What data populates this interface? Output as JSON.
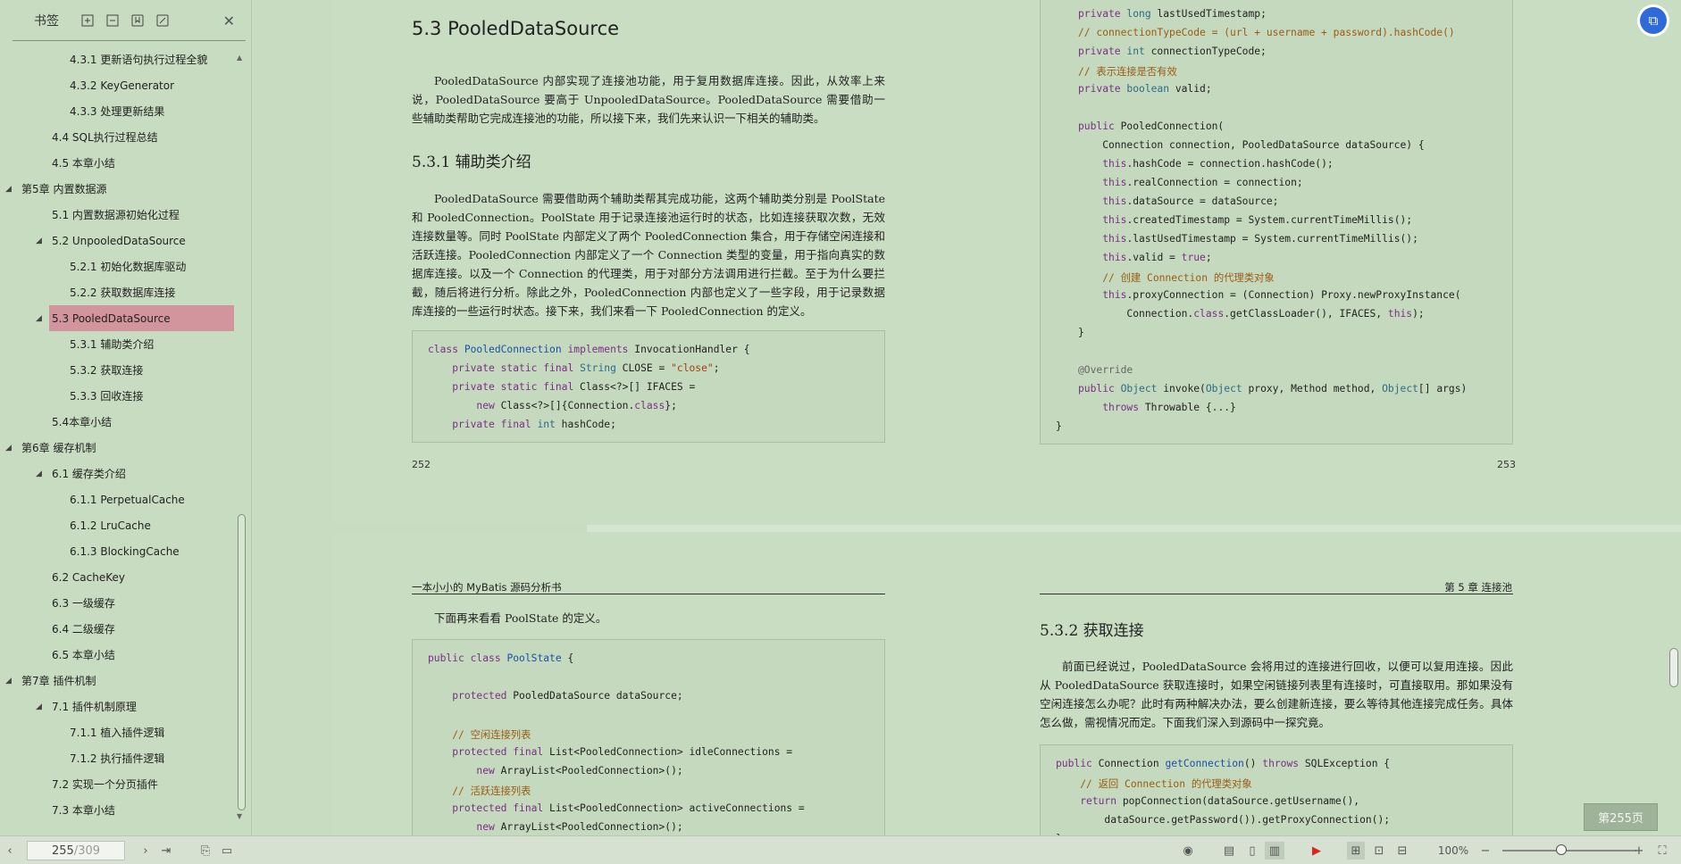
{
  "sidebar": {
    "title": "书签",
    "close_icon": "close-icon",
    "items": [
      {
        "label": "4.3.1 更新语句执行过程全貌",
        "level": 3,
        "toggle": ""
      },
      {
        "label": "4.3.2 KeyGenerator",
        "level": 3,
        "toggle": ""
      },
      {
        "label": "4.3.3 处理更新结果",
        "level": 3,
        "toggle": ""
      },
      {
        "label": "4.4 SQL执行过程总结",
        "level": 2,
        "toggle": ""
      },
      {
        "label": "4.5 本章小结",
        "level": 2,
        "toggle": ""
      },
      {
        "label": "第5章 内置数据源",
        "level": 1,
        "toggle": "◢"
      },
      {
        "label": "5.1 内置数据源初始化过程",
        "level": 2,
        "toggle": ""
      },
      {
        "label": "5.2 UnpooledDataSource",
        "level": 2,
        "toggle": "◢"
      },
      {
        "label": "5.2.1 初始化数据库驱动",
        "level": 3,
        "toggle": ""
      },
      {
        "label": "5.2.2 获取数据库连接",
        "level": 3,
        "toggle": ""
      },
      {
        "label": "5.3 PooledDataSource",
        "level": 2,
        "toggle": "◢",
        "selected": true
      },
      {
        "label": "5.3.1 辅助类介绍",
        "level": 3,
        "toggle": ""
      },
      {
        "label": "5.3.2 获取连接",
        "level": 3,
        "toggle": ""
      },
      {
        "label": "5.3.3 回收连接",
        "level": 3,
        "toggle": ""
      },
      {
        "label": "5.4本章小结",
        "level": 2,
        "toggle": ""
      },
      {
        "label": "第6章 缓存机制",
        "level": 1,
        "toggle": "◢"
      },
      {
        "label": "6.1 缓存类介绍",
        "level": 2,
        "toggle": "◢"
      },
      {
        "label": "6.1.1 PerpetualCache",
        "level": 3,
        "toggle": ""
      },
      {
        "label": "6.1.2 LruCache",
        "level": 3,
        "toggle": ""
      },
      {
        "label": "6.1.3 BlockingCache",
        "level": 3,
        "toggle": ""
      },
      {
        "label": "6.2 CacheKey",
        "level": 2,
        "toggle": ""
      },
      {
        "label": "6.3 一级缓存",
        "level": 2,
        "toggle": ""
      },
      {
        "label": "6.4 二级缓存",
        "level": 2,
        "toggle": ""
      },
      {
        "label": "6.5 本章小结",
        "level": 2,
        "toggle": ""
      },
      {
        "label": "第7章 插件机制",
        "level": 1,
        "toggle": "◢"
      },
      {
        "label": "7.1 插件机制原理",
        "level": 2,
        "toggle": "◢"
      },
      {
        "label": "7.1.1 植入插件逻辑",
        "level": 3,
        "toggle": ""
      },
      {
        "label": "7.1.2 执行插件逻辑",
        "level": 3,
        "toggle": ""
      },
      {
        "label": "7.2 实现一个分页插件",
        "level": 2,
        "toggle": ""
      },
      {
        "label": "7.3 本章小结",
        "level": 2,
        "toggle": ""
      }
    ]
  },
  "page252": {
    "heading": "5.3 PooledDataSource",
    "intro": "PooledDataSource 内部实现了连接池功能，用于复用数据库连接。因此，从效率上来说，PooledDataSource 要高于 UnpooledDataSource。PooledDataSource 需要借助一些辅助类帮助它完成连接池的功能，所以接下来，我们先来认识一下相关的辅助类。",
    "subheading": "5.3.1  辅助类介绍",
    "body": "PooledDataSource 需要借助两个辅助类帮其完成功能，这两个辅助类分别是 PoolState 和 PooledConnection。PoolState 用于记录连接池运行时的状态，比如连接获取次数，无效连接数量等。同时 PoolState 内部定义了两个 PooledConnection 集合，用于存储空闲连接和活跃连接。PooledConnection 内部定义了一个 Connection 类型的变量，用于指向真实的数据库连接。以及一个 Connection 的代理类，用于对部分方法调用进行拦截。至于为什么要拦截，随后将进行分析。除此之外，PooledConnection 内部也定义了一些字段，用于记录数据库连接的一些运行时状态。接下来，我们来看一下 PooledConnection 的定义。",
    "page_number": "252"
  },
  "page253": {
    "page_number": "253"
  },
  "page254": {
    "running_head": "一本小小的 MyBatis 源码分析书",
    "intro": "下面再来看看 PoolState 的定义。"
  },
  "page255": {
    "running_head": "第 5 章  连接池",
    "subheading": "5.3.2  获取连接",
    "body": "前面已经说过，PooledDataSource 会将用过的连接进行回收，以便可以复用连接。因此从 PooledDataSource 获取连接时，如果空闲链接列表里有连接时，可直接取用。那如果没有空闲连接怎么办呢？此时有两种解决办法，要么创建新连接，要么等待其他连接完成任务。具体怎么做，需视情况而定。下面我们深入到源码中一探究竟。"
  },
  "statusbar": {
    "current_page": "255",
    "total_pages": "/309",
    "zoom": "100%",
    "page_badge": "第255页"
  }
}
